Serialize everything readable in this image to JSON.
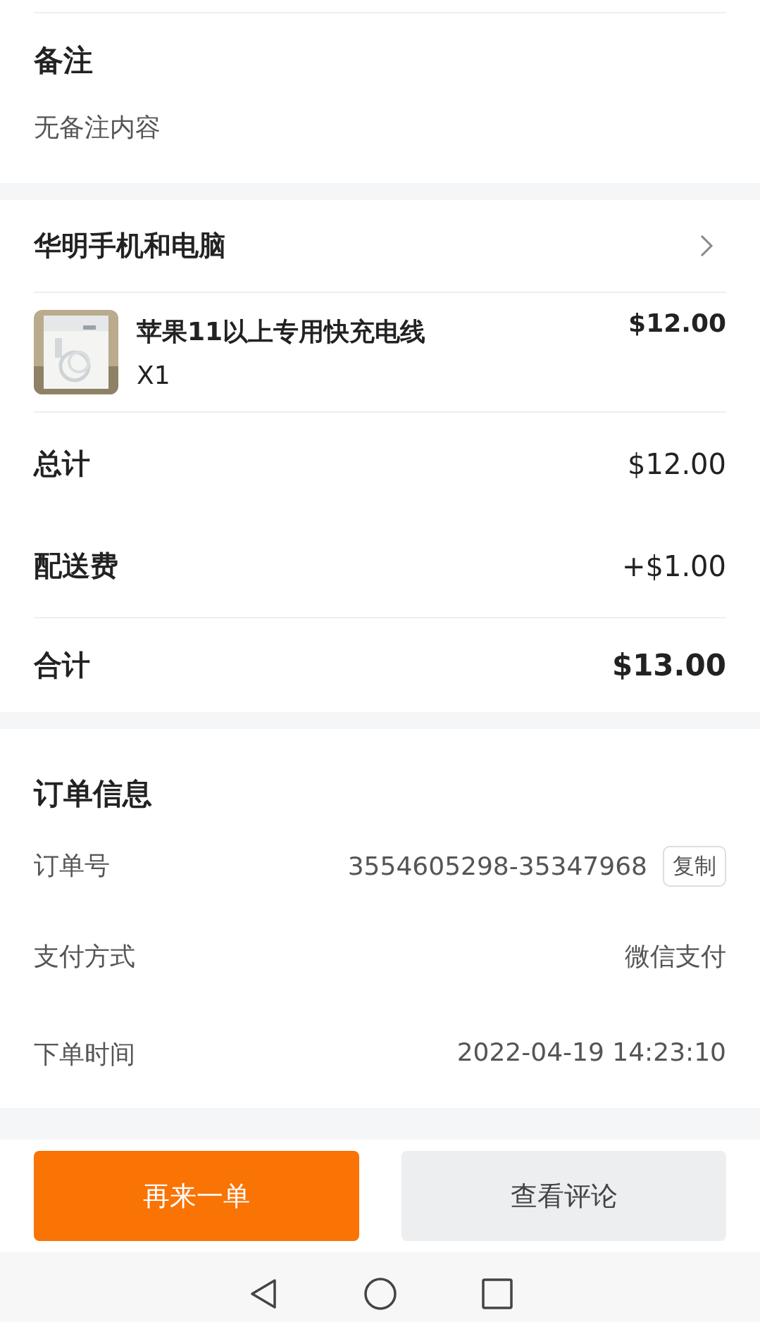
{
  "remark": {
    "title": "备注",
    "content": "无备注内容"
  },
  "shop": {
    "name": "华明手机和电脑"
  },
  "items": [
    {
      "name": "苹果11以上专用快充电线",
      "quantity": "X1",
      "price": "$12.00"
    }
  ],
  "summary": [
    {
      "label": "总计",
      "value": "$12.00",
      "kind": "subtotal"
    },
    {
      "label": "配送费",
      "value": "+$1.00",
      "kind": "fee"
    },
    {
      "label": "合计",
      "value": "$13.00",
      "kind": "total"
    }
  ],
  "order_info": {
    "title": "订单信息",
    "rows": [
      {
        "label": "订单号",
        "value": "3554605298-35347968",
        "action": "复制"
      },
      {
        "label": "支付方式",
        "value": "微信支付"
      },
      {
        "label": "下单时间",
        "value": "2022-04-19 14:23:10"
      }
    ]
  },
  "actions": [
    {
      "label": "再来一单",
      "kind": "primary"
    },
    {
      "label": "查看评论",
      "kind": "secondary"
    }
  ]
}
